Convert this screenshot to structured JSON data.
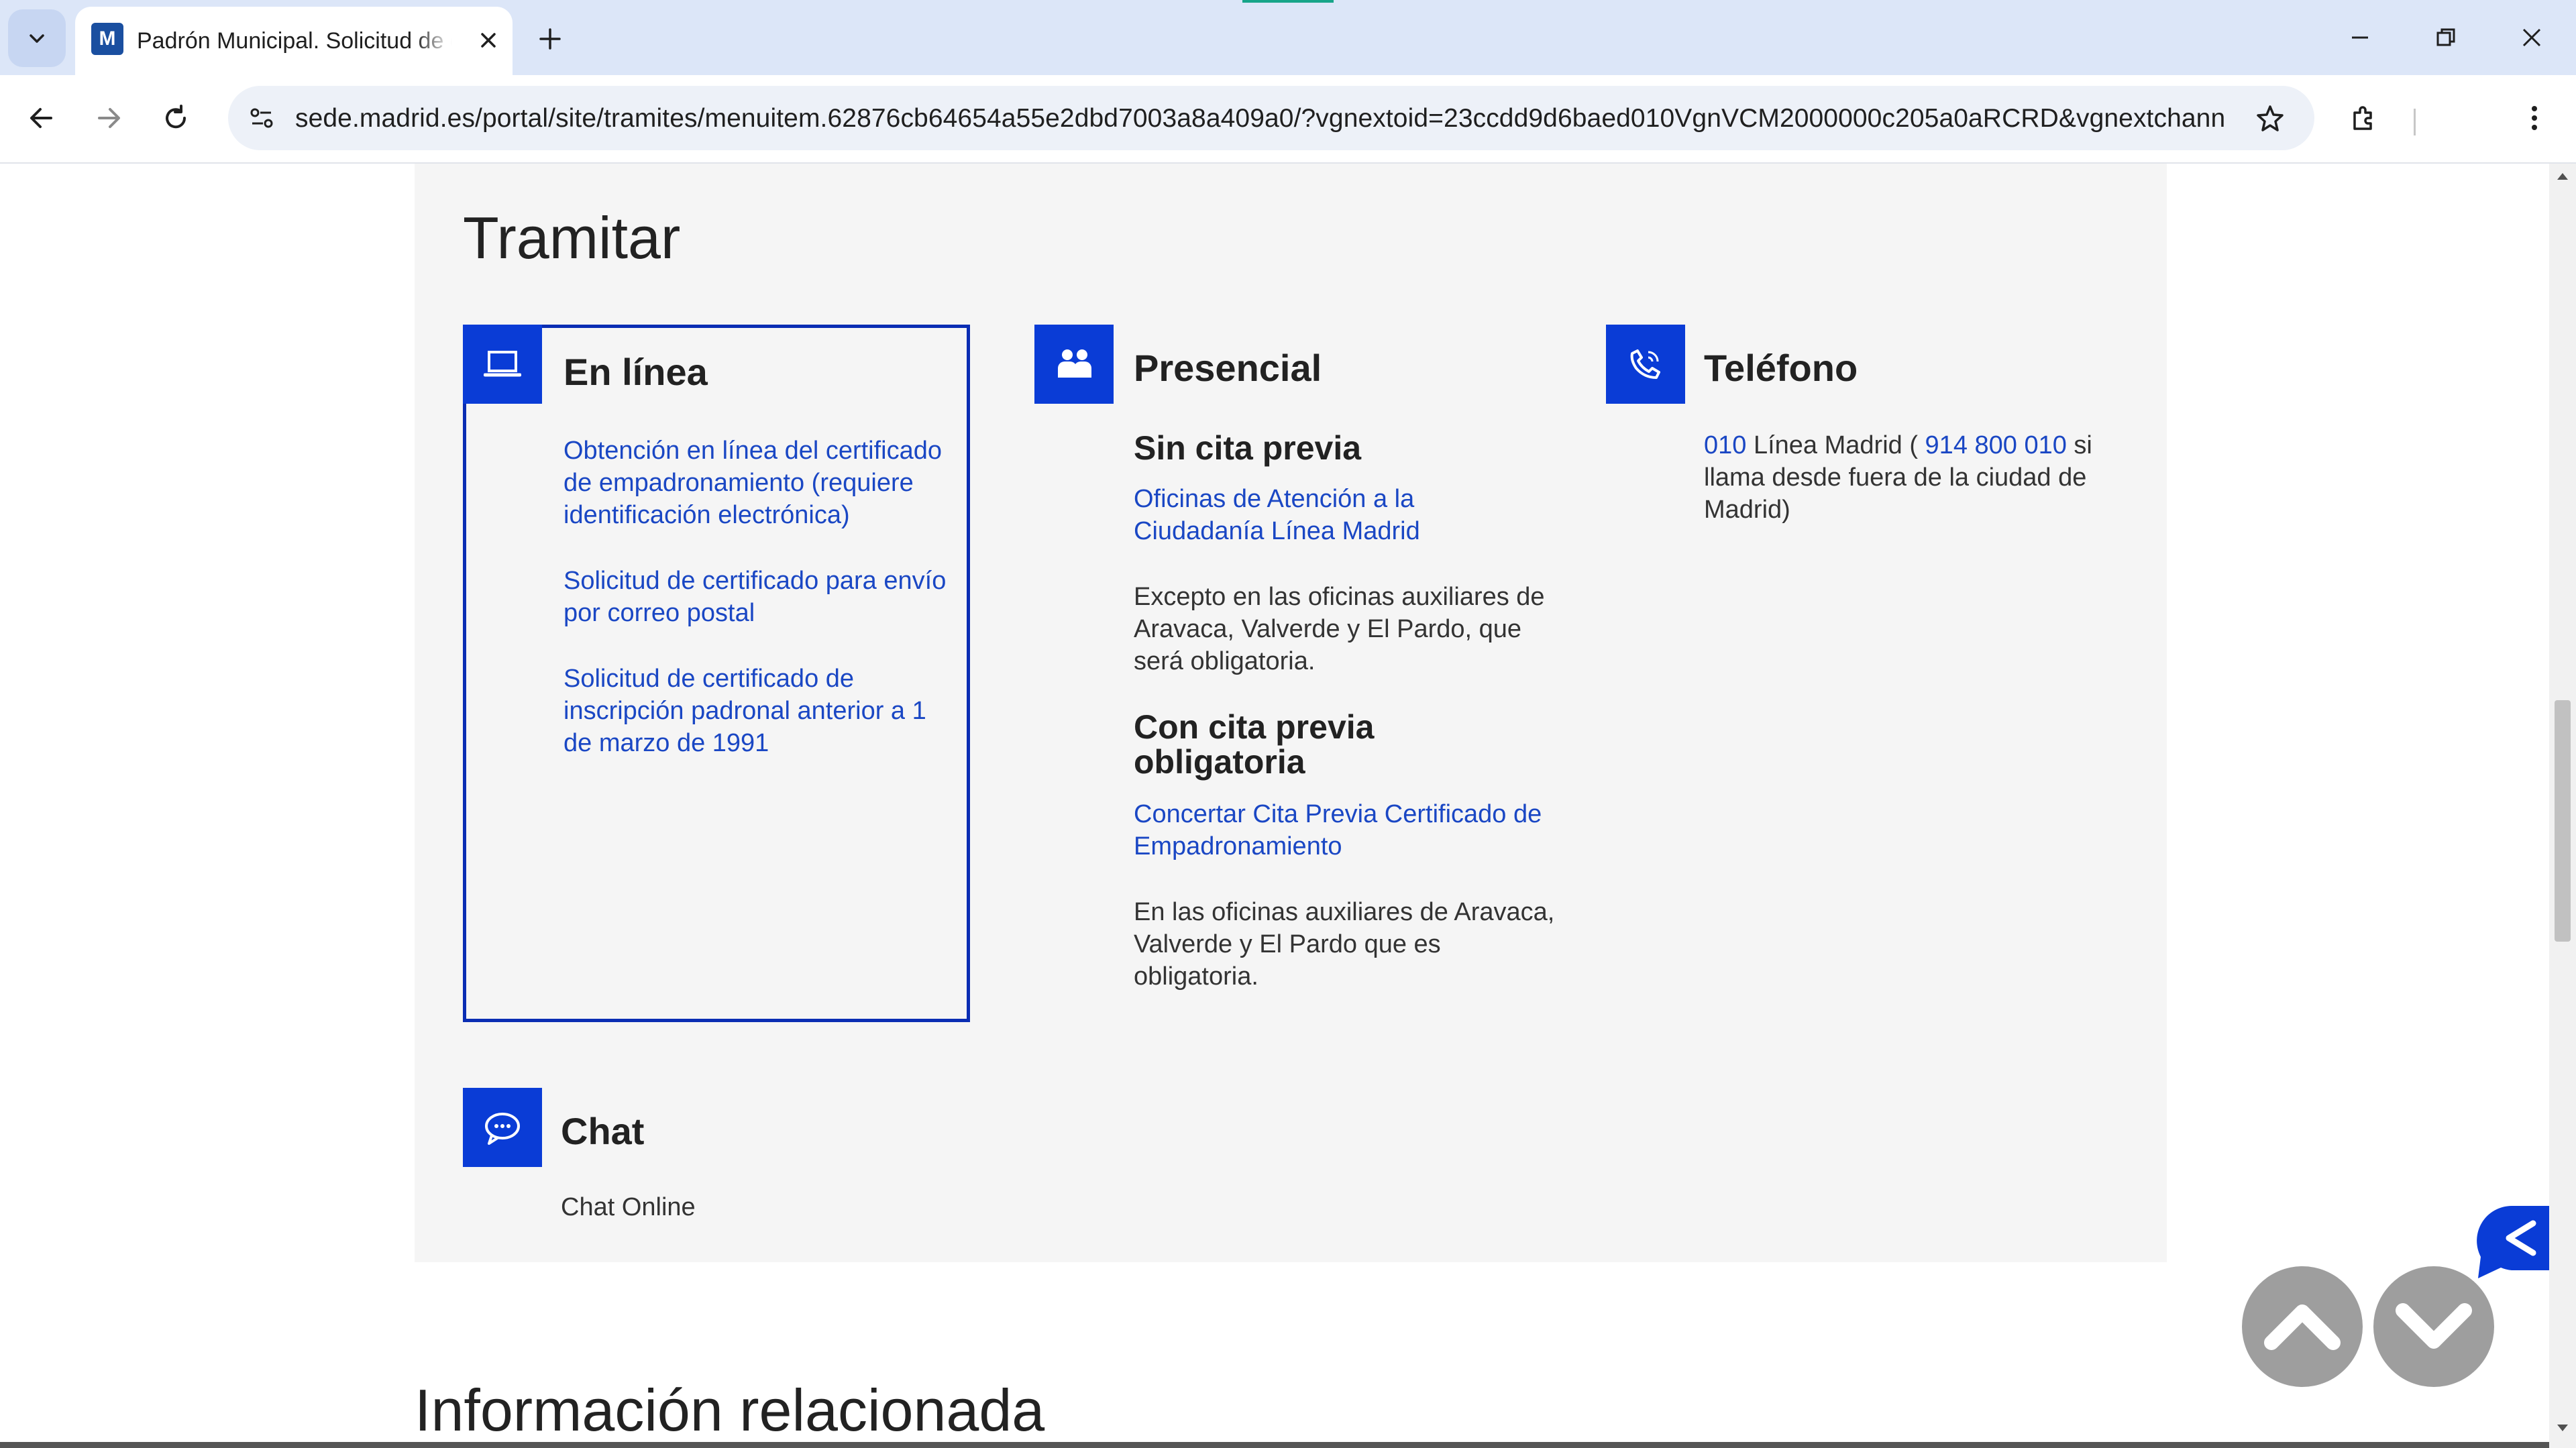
{
  "browser": {
    "tab_title": "Padrón Municipal. Solicitud de certificado",
    "url": "sede.madrid.es/portal/site/tramites/menuitem.62876cb64654a55e2dbd7003a8a409a0/?vgnextoid=23ccdd9d6baed010VgnVCM2000000c205a0aRCRD&vgnextchann...",
    "icons": [
      "tab-list-icon",
      "close-icon",
      "plus-icon",
      "minimize-icon",
      "restore-icon",
      "window-close-icon",
      "back-arrow-icon",
      "forward-arrow-icon",
      "reload-icon",
      "site-settings-icon",
      "star-icon",
      "extensions-icon",
      "kebab-menu-icon"
    ]
  },
  "page": {
    "section_title": "Tramitar",
    "online": {
      "title": "En línea",
      "icon": "laptop-icon",
      "links": [
        "Obtención en línea del certificado de empadronamiento (requiere identificación electrónica)",
        "Solicitud de certificado para envío por correo postal",
        "Solicitud de certificado de inscripción padronal anterior a 1 de marzo de 1991"
      ]
    },
    "presencial": {
      "title": "Presencial",
      "icon": "people-icon",
      "sin_cita_title": "Sin cita previa",
      "sin_cita_link": "Oficinas de Atención a la Ciudadanía Línea Madrid",
      "sin_cita_text": "Excepto en las oficinas auxiliares de Aravaca, Valverde y El Pardo, que será obligatoria.",
      "con_cita_title": "Con cita previa obligatoria",
      "con_cita_link": "Concertar Cita Previa Certificado de Empadronamiento",
      "con_cita_text": "En las oficinas auxiliares de Aravaca, Valverde y El Pardo que es obligatoria."
    },
    "telefono": {
      "title": "Teléfono",
      "icon": "phone-icon",
      "num_010": "010",
      "text_1": " Línea Madrid ( ",
      "num_long": "914 800 010",
      "text_2": " si llama desde fuera de la ciudad de Madrid)"
    },
    "chat": {
      "title": "Chat",
      "icon": "chat-icon",
      "text": "Chat Online"
    },
    "related_title": "Información relacionada"
  },
  "colors": {
    "accent_blue": "#0a3cd6",
    "link_blue": "#1a47c4",
    "panel_bg": "#f5f5f5",
    "scroll_button_gray": "#9e9e9e"
  }
}
